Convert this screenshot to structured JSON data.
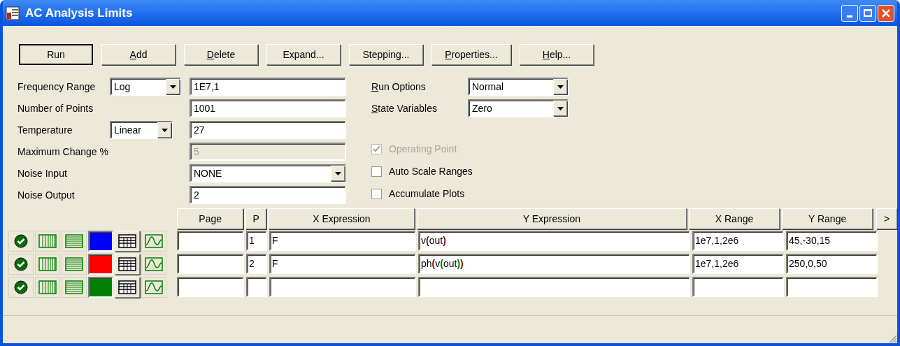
{
  "window": {
    "title": "AC Analysis Limits"
  },
  "buttons": [
    {
      "label": {
        "key": "R",
        "post": "un"
      },
      "underline": false,
      "default": true
    },
    {
      "label": {
        "key": "A",
        "post": "dd"
      },
      "underline": true,
      "default": false
    },
    {
      "label": {
        "key": "D",
        "post": "elete"
      },
      "underline": true,
      "default": false
    },
    {
      "label": {
        "key": "E",
        "post": "xpand..."
      },
      "underline": false,
      "default": false
    },
    {
      "label": {
        "key": "S",
        "post": "tepping..."
      },
      "underline": false,
      "default": false
    },
    {
      "label": {
        "key": "P",
        "post": "roperties..."
      },
      "underline": true,
      "default": false
    },
    {
      "label": {
        "key": "H",
        "post": "elp..."
      },
      "underline": true,
      "default": false
    }
  ],
  "settings": [
    {
      "label": "Frequency Range",
      "selector": "Log",
      "value": "1E7,1",
      "kind": "text",
      "disabled": false
    },
    {
      "label": "Number of Points",
      "value": "1001",
      "kind": "text",
      "disabled": false
    },
    {
      "label": "Temperature",
      "selector": "Linear",
      "value": "27",
      "kind": "text",
      "disabled": false
    },
    {
      "label": "Maximum Change %",
      "value": "5",
      "kind": "text",
      "disabled": true
    },
    {
      "label": "Noise Input",
      "value": "NONE",
      "kind": "dropdown",
      "disabled": false
    },
    {
      "label": "Noise Output",
      "value": "2",
      "kind": "text",
      "disabled": false
    }
  ],
  "options": [
    {
      "label": {
        "key": "R",
        "post": "un Options"
      },
      "value": "Normal"
    },
    {
      "label": {
        "key": "S",
        "post": "tate Variables"
      },
      "value": "Zero"
    }
  ],
  "checkboxes": [
    {
      "label": "Operating Point",
      "checked": true,
      "disabled": true
    },
    {
      "label": "Auto Scale Ranges",
      "checked": false,
      "disabled": false
    },
    {
      "label": "Accumulate Plots",
      "checked": false,
      "disabled": false
    }
  ],
  "table": {
    "columns": [
      "Page",
      "P",
      "X Expression",
      "Y Expression",
      "X Range",
      "Y Range"
    ],
    "more_button": ">",
    "rows": [
      {
        "color": "#0000ff",
        "page": "",
        "p": "1",
        "x_expression": "F",
        "y_expression": [
          {
            "text": "v"
          },
          {
            "text": "(",
            "color": "#8b0000"
          },
          {
            "text": "out"
          },
          {
            "text": ")",
            "color": "#8b0000"
          }
        ],
        "x_range": "1e7,1,2e6",
        "y_range": "45,-30,15"
      },
      {
        "color": "#ff0000",
        "page": "",
        "p": "2",
        "x_expression": "F",
        "y_expression": [
          {
            "text": "ph"
          },
          {
            "text": "(",
            "color": "#8b0000"
          },
          {
            "text": "v"
          },
          {
            "text": "(",
            "color": "#008000"
          },
          {
            "text": "out"
          },
          {
            "text": ")",
            "color": "#008000"
          },
          {
            "text": ")",
            "color": "#8b0000"
          }
        ],
        "x_range": "1e7,1,2e6",
        "y_range": "250,0,50"
      },
      {
        "color": "#008000",
        "page": "",
        "p": "",
        "x_expression": "",
        "y_expression": [],
        "x_range": "",
        "y_range": ""
      }
    ]
  }
}
